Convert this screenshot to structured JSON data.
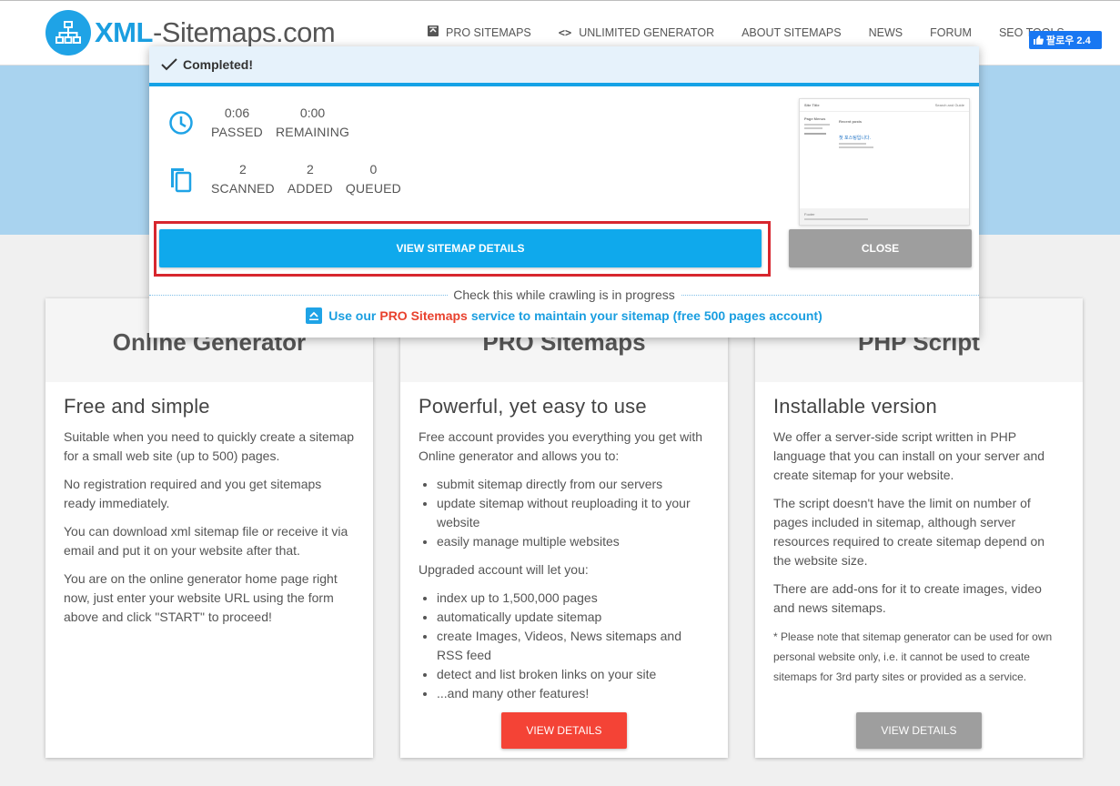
{
  "header": {
    "logo_bold": "XML",
    "logo_rest": "-Sitemaps.com",
    "nav": [
      {
        "label": "PRO SITEMAPS",
        "icon": "pro-icon"
      },
      {
        "label": "UNLIMITED GENERATOR",
        "icon": "code-icon"
      },
      {
        "label": "ABOUT SITEMAPS"
      },
      {
        "label": "NEWS"
      },
      {
        "label": "FORUM"
      },
      {
        "label": "SEO TOOLS"
      }
    ],
    "follow": "팔로우 2.4"
  },
  "modal": {
    "status": "Completed!",
    "time": [
      {
        "value": "0:06",
        "label": "PASSED"
      },
      {
        "value": "0:00",
        "label": "REMAINING"
      }
    ],
    "pages": [
      {
        "value": "2",
        "label": "SCANNED"
      },
      {
        "value": "2",
        "label": "ADDED"
      },
      {
        "value": "0",
        "label": "QUEUED"
      }
    ],
    "thumb": {
      "site_title": "Site Title",
      "search": "Search and Guide",
      "side_heading": "Page Menus",
      "section": "Recent posts",
      "post_title": "첫 포스팅입니다.",
      "footer": "Footer"
    },
    "view_button": "VIEW SITEMAP DETAILS",
    "close_button": "CLOSE",
    "divider_text": "Check this while crawling is in progress",
    "promo_pre": "Use our",
    "promo_pro": "PRO Sitemaps",
    "promo_post": "service to maintain your sitemap (free 500 pages account)"
  },
  "cards": [
    {
      "title": "Online Generator",
      "subtitle": "Free and simple",
      "p1": "Suitable when you need to quickly create a sitemap for a small web site (up to 500) pages.",
      "p2": "No registration required and you get sitemaps ready immediately.",
      "p3": "You can download xml sitemap file or receive it via email and put it on your website after that.",
      "p4": "You are on the online generator home page right now, just enter your website URL using the form above and click \"START\" to proceed!"
    },
    {
      "title": "PRO Sitemaps",
      "subtitle": "Powerful, yet easy to use",
      "p1": "Free account provides you everything you get with Online generator and allows you to:",
      "list1": [
        "submit sitemap directly from our servers",
        "update sitemap without reuploading it to your website",
        "easily manage multiple websites"
      ],
      "p2": "Upgraded account will let you:",
      "list2": [
        "index up to 1,500,000 pages",
        "automatically update sitemap",
        "create Images, Videos, News sitemaps and RSS feed",
        "detect and list broken links on your site",
        "...and many other features!"
      ],
      "button": "VIEW DETAILS",
      "button_color": "#f44336"
    },
    {
      "title": "PHP Script",
      "subtitle": "Installable version",
      "p1": "We offer a server-side script written in PHP language that you can install on your server and create sitemap for your website.",
      "p2": "The script doesn't have the limit on number of pages included in sitemap, although server resources required to create sitemap depend on the website size.",
      "p3": "There are add-ons for it to create images, video and news sitemaps.",
      "p4": "* Please note that sitemap generator can be used for own personal website only, i.e. it cannot be used to create sitemaps for 3rd party sites or provided as a service.",
      "button": "VIEW DETAILS",
      "button_color": "#9e9e9e"
    }
  ]
}
